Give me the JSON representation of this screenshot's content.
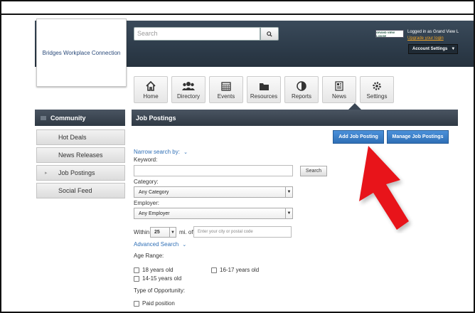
{
  "header": {
    "org_name": "Bridges Workplace Connection",
    "search_placeholder": "Search",
    "brand_text": "GRAND VIEW LODGE",
    "logged_in": "Logged in as Grand View L",
    "upgrade": "Upgrade your login",
    "account_settings": "Account Settings"
  },
  "nav": {
    "tiles": [
      {
        "label": "Home",
        "icon": "home-icon"
      },
      {
        "label": "Directory",
        "icon": "people-icon"
      },
      {
        "label": "Events",
        "icon": "calendar-icon"
      },
      {
        "label": "Resources",
        "icon": "folder-icon"
      },
      {
        "label": "Reports",
        "icon": "pie-chart-icon"
      },
      {
        "label": "News",
        "icon": "newspaper-icon"
      },
      {
        "label": "Settings",
        "icon": "gear-icon"
      }
    ]
  },
  "sidebar": {
    "heading": "Community",
    "items": [
      {
        "label": "Hot Deals"
      },
      {
        "label": "News Releases"
      },
      {
        "label": "Job Postings"
      },
      {
        "label": "Social Feed"
      }
    ]
  },
  "main": {
    "heading": "Job Postings",
    "add_button": "Add Job Posting",
    "manage_button": "Manage Job Postings",
    "narrow": "Narrow search by:",
    "keyword_label": "Keyword:",
    "search_button": "Search",
    "category_label": "Category:",
    "category_value": "Any Category",
    "employer_label": "Employer:",
    "employer_value": "Any Employer",
    "within": "Within",
    "within_value": "25",
    "mi_of": "mi. of",
    "city_placeholder": "Enter your city or postal code",
    "advanced": "Advanced Search",
    "age_label": "Age Range:",
    "age_options": [
      "18 years old",
      "16-17 years old",
      "14-15 years old"
    ],
    "type_label": "Type of Opportunity:",
    "type_options": [
      "Paid position"
    ]
  },
  "colors": {
    "header_bg": "#2b3947",
    "accent_blue": "#2f6fb6",
    "upgrade_orange": "#f5a623",
    "arrow_red": "#e8141a"
  }
}
